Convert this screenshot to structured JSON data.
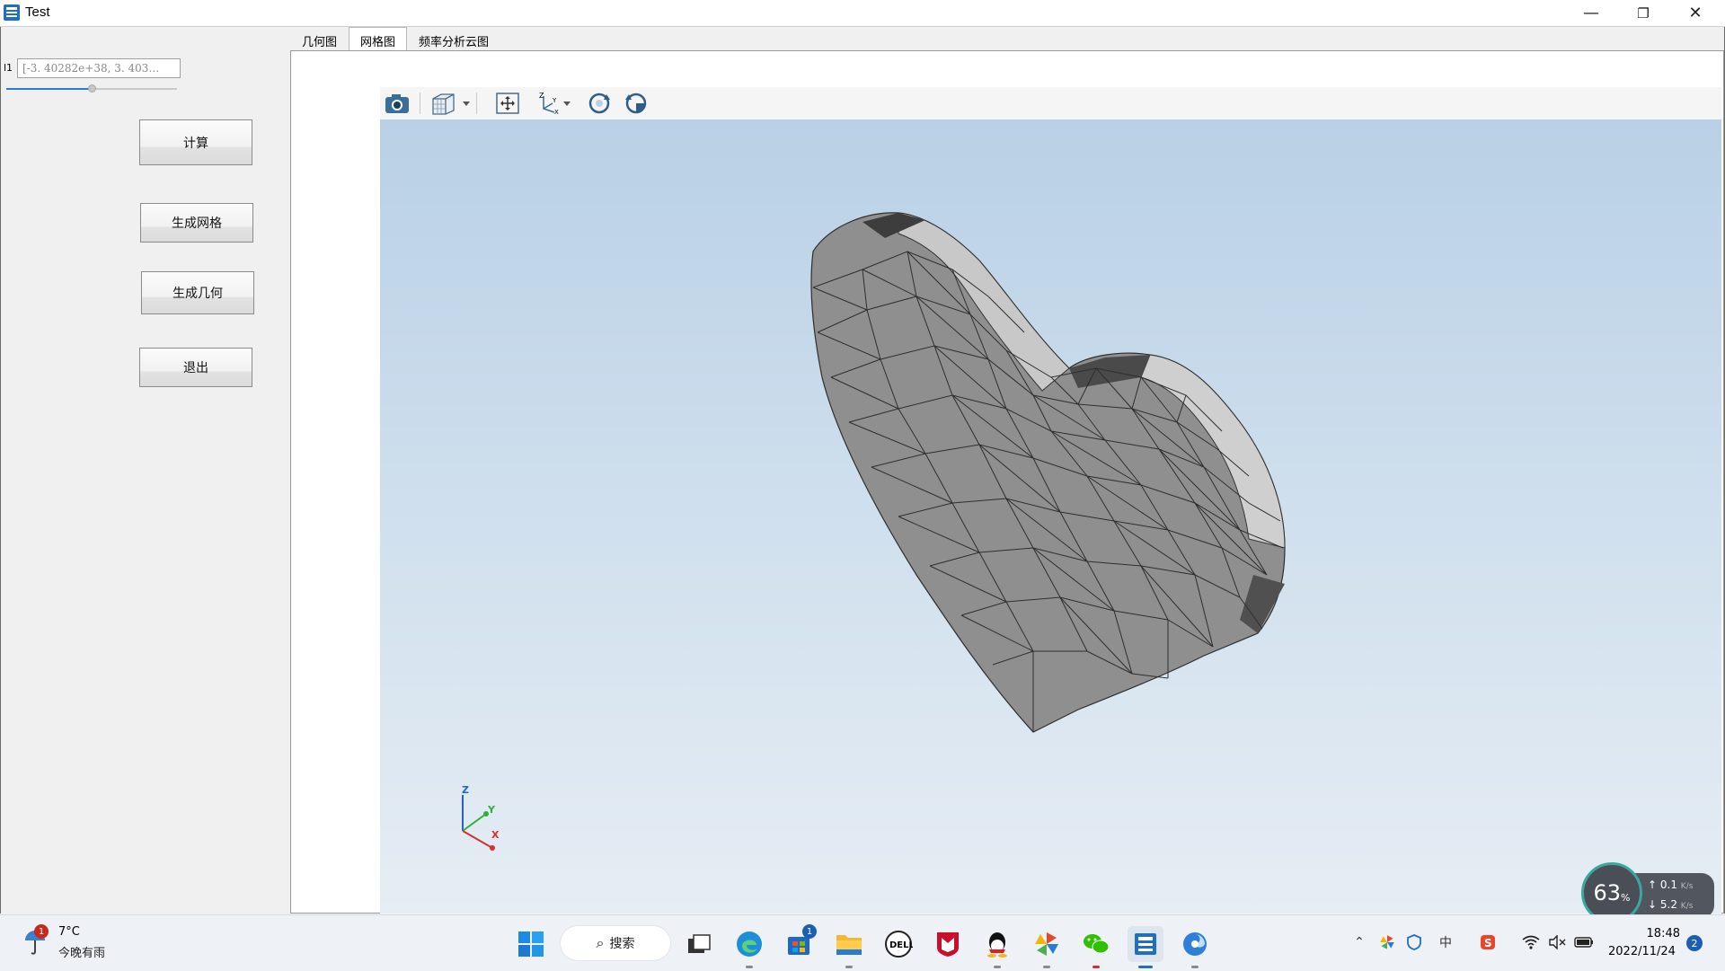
{
  "window": {
    "title": "Test",
    "minimize": "—",
    "restore": "❐",
    "close": "✕"
  },
  "left_panel": {
    "param_label": "l1",
    "param_value": "[-3. 40282e+38, 3. 403…",
    "slider_value": 0.5,
    "buttons": {
      "compute": "计算",
      "mesh": "生成网格",
      "geometry": "生成几何",
      "exit": "退出"
    }
  },
  "tabs": [
    {
      "label": "几何图",
      "active": false
    },
    {
      "label": "网格图",
      "active": true
    },
    {
      "label": "频率分析云图",
      "active": false
    }
  ],
  "viewer": {
    "toolbar_icons": [
      "camera-icon",
      "view-cube-icon",
      "fit-all-icon",
      "axes-icon",
      "rotate-icon",
      "reset-view-icon"
    ],
    "axis_labels": {
      "x": "X",
      "y": "Y",
      "z": "Z"
    },
    "mesh_color": "#8f8f8f"
  },
  "taskbar": {
    "weather": {
      "badge": "1",
      "temp": "7°C",
      "desc": "今晚有雨"
    },
    "search_label": "搜索",
    "store_badge": "1",
    "clock": {
      "time": "18:48",
      "date": "2022/11/24"
    },
    "notifications": "2",
    "input_method": "中"
  },
  "speed_widget": {
    "percent": "63",
    "percent_sign": "%",
    "upload": "0.1",
    "download": "5.2",
    "unit": "K/s"
  }
}
